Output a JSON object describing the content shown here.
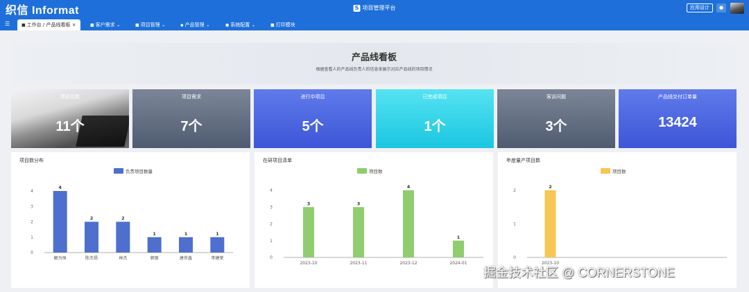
{
  "topbar": {
    "logo": "织信 Informat",
    "app_icon": "S",
    "app_title": "项目管理平台",
    "design_button": "应用设计",
    "notify_icon": "bell-icon"
  },
  "nav": {
    "menu_icon": "menu-icon",
    "tabs": [
      {
        "label": "工作台 / 产品线看板",
        "icon": "home-icon",
        "active": true
      },
      {
        "label": "客户需求",
        "icon": "list-icon"
      },
      {
        "label": "项目管理",
        "icon": "folder-icon"
      },
      {
        "label": "产品管理",
        "icon": "cube-icon"
      },
      {
        "label": "系统配置",
        "icon": "user-icon"
      },
      {
        "label": "打印模块",
        "icon": "print-icon"
      }
    ]
  },
  "banner": {
    "title": "产品线看板",
    "subtitle": "根据查看人的产品线负责人的信息来展示对应产品线的项目情况"
  },
  "stats": [
    {
      "label": "项目总数",
      "value": "11个",
      "style": "photo"
    },
    {
      "label": "项目需求",
      "value": "7个",
      "style": "grey"
    },
    {
      "label": "进行中项目",
      "value": "5个",
      "style": "blue"
    },
    {
      "label": "已完成项目",
      "value": "1个",
      "style": "cyan"
    },
    {
      "label": "客诉问题",
      "value": "3个",
      "style": "grey"
    },
    {
      "label": "产品线交付订单量",
      "value": "13424",
      "style": "blue"
    }
  ],
  "chart_data": [
    {
      "type": "bar",
      "title": "项目数分布",
      "color": "#4e6fce",
      "series": [
        {
          "name": "负责项目数量",
          "values": [
            4,
            2,
            2,
            1,
            1,
            1
          ]
        }
      ],
      "categories": [
        "解为恒",
        "陈杰扬",
        "林杰",
        "郭丽",
        "唐世鑫",
        "李建荣"
      ],
      "yticks": [
        0,
        1,
        2,
        3,
        4
      ],
      "ylim": [
        0,
        4
      ],
      "legend": "top-center",
      "grid": false
    },
    {
      "type": "bar",
      "title": "在研项目清单",
      "color": "#8fcd6f",
      "series": [
        {
          "name": "项目数",
          "values": [
            3,
            3,
            4,
            1
          ]
        }
      ],
      "categories": [
        "2023-10",
        "2023-11",
        "2023-12",
        "2024-01"
      ],
      "yticks": [
        0,
        1,
        2,
        3,
        4
      ],
      "ylim": [
        0,
        4
      ],
      "legend": "top-center",
      "grid": false
    },
    {
      "type": "bar",
      "title": "年度量产项目数",
      "color": "#f7c654",
      "series": [
        {
          "name": "项目数",
          "values": [
            2
          ]
        }
      ],
      "categories": [
        "2023-10"
      ],
      "yticks": [
        0,
        1,
        2
      ],
      "ylim": [
        0,
        2
      ],
      "legend": "top-center",
      "grid": false
    }
  ],
  "watermark": "掘金技术社区 @ CORNERSTONE"
}
